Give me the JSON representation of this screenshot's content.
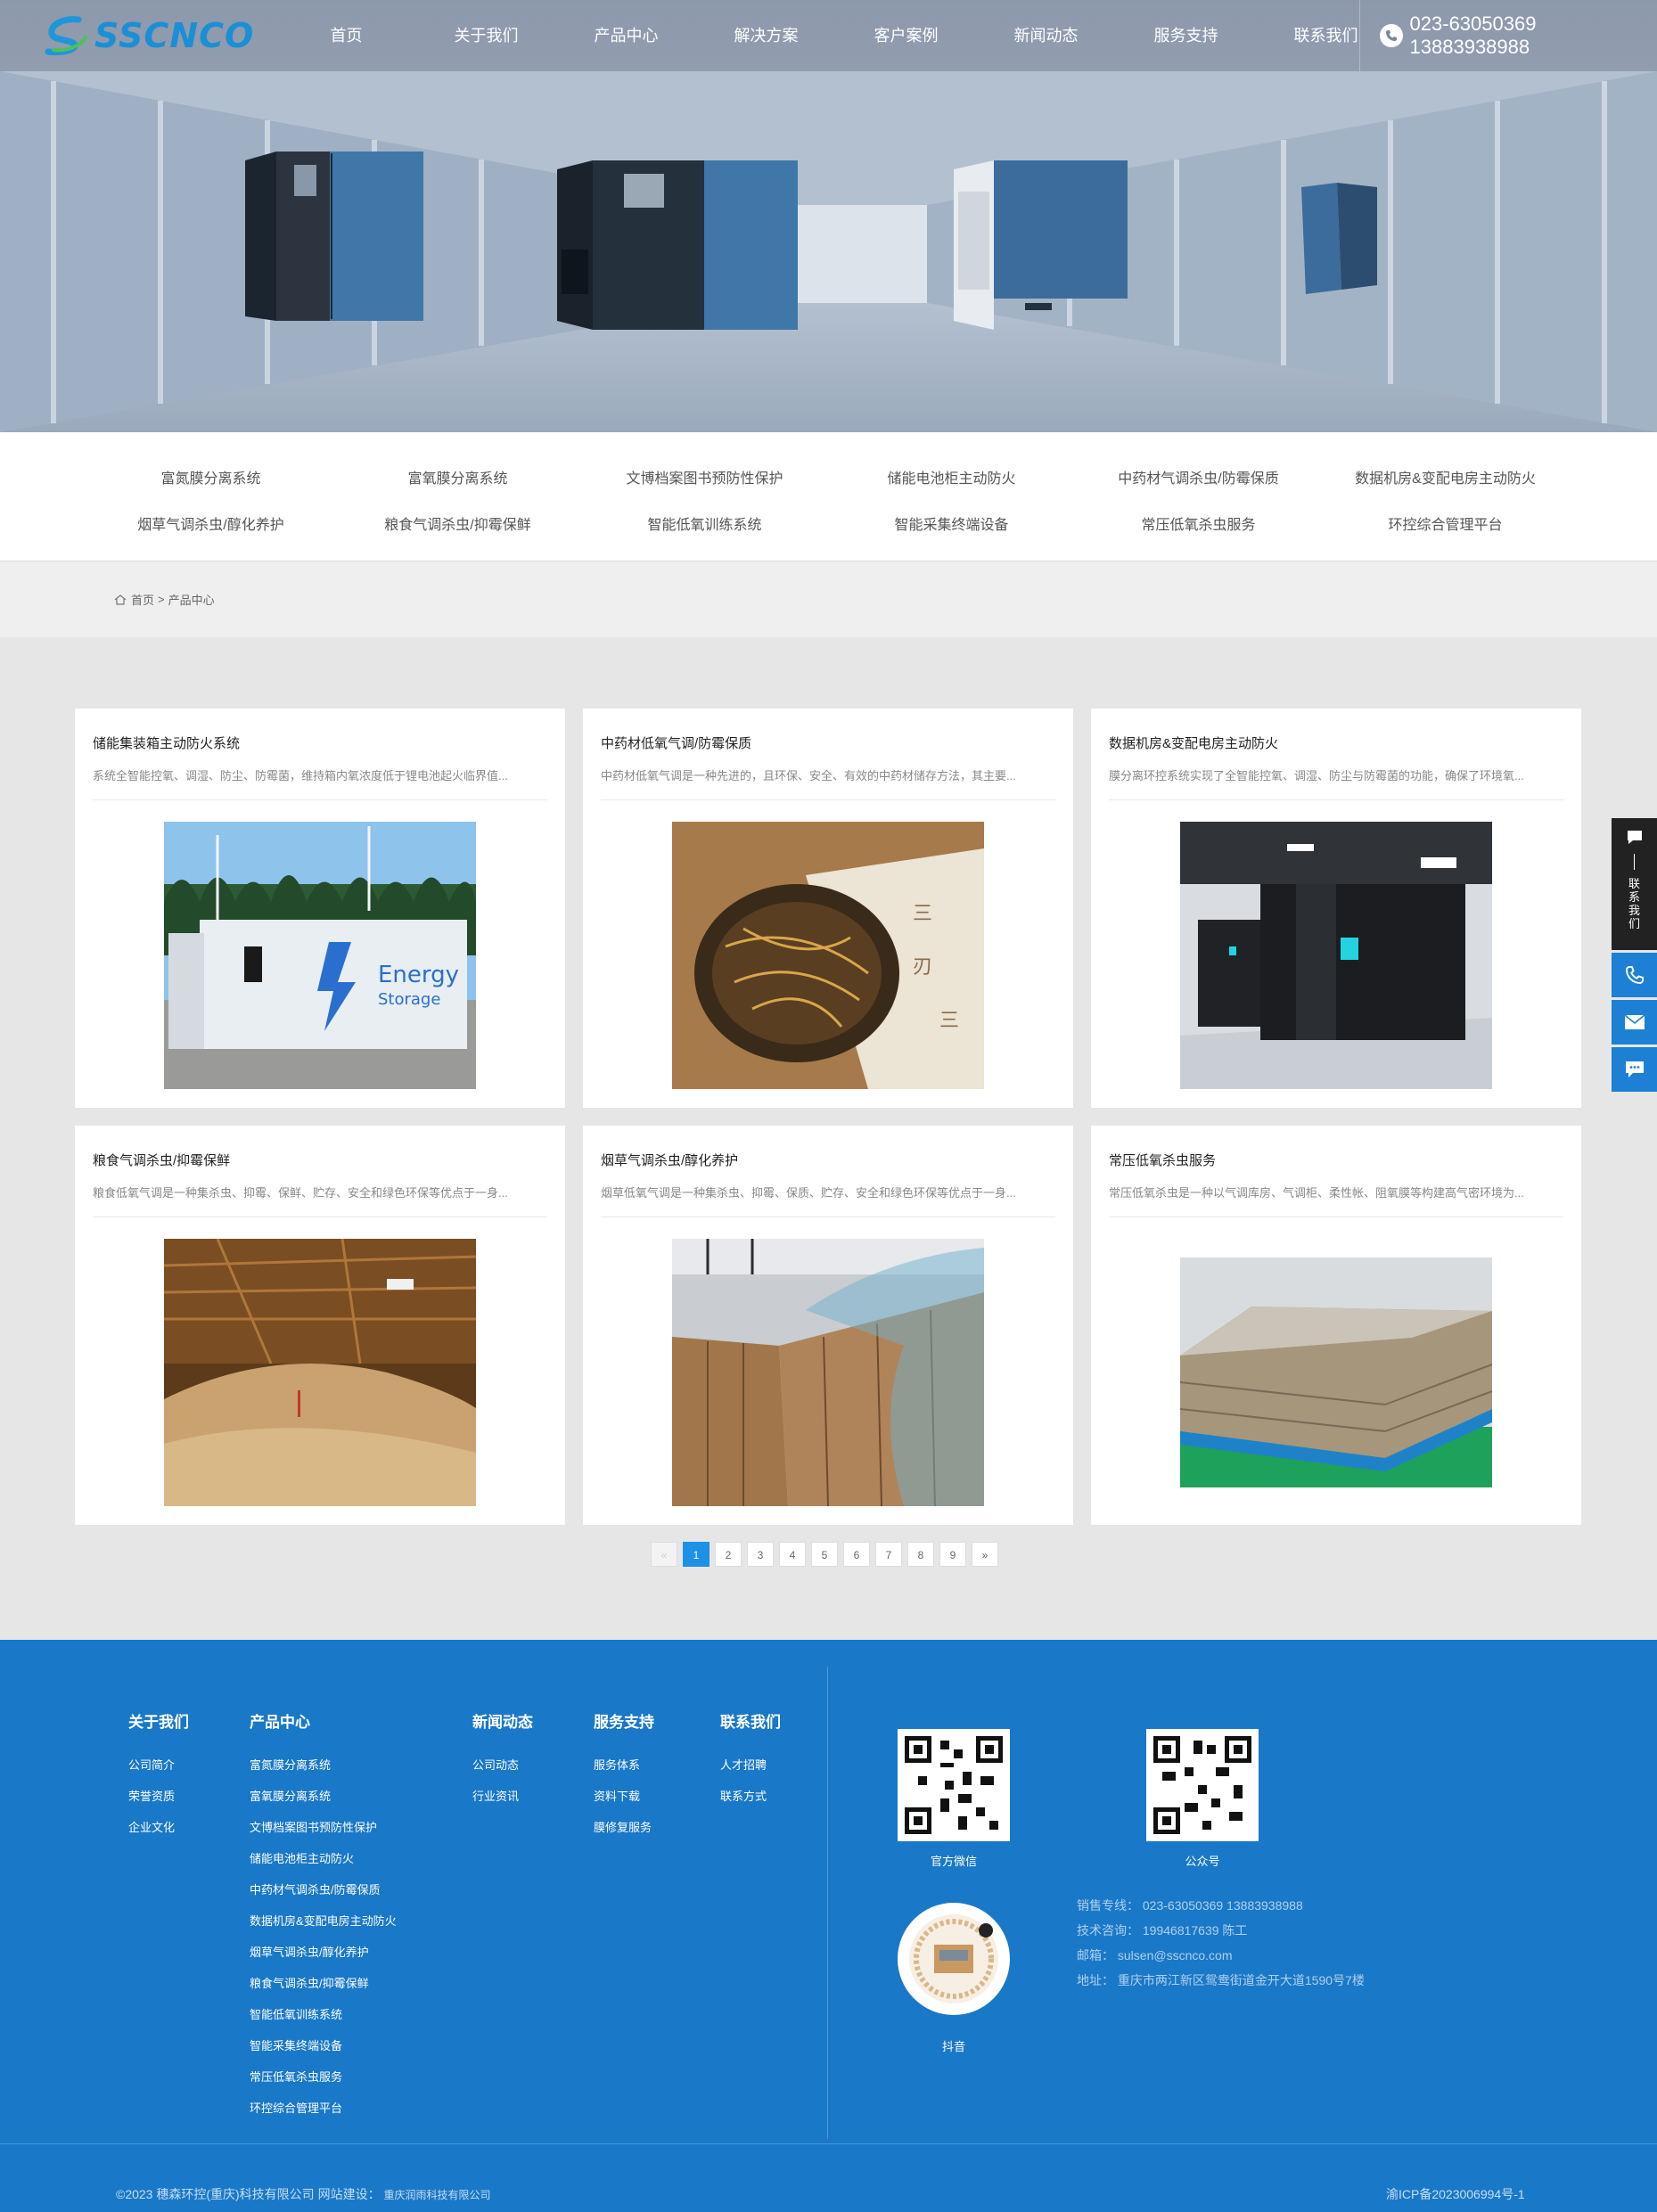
{
  "header": {
    "logo_text": "SSCNCO",
    "nav": [
      "首页",
      "关于我们",
      "产品中心",
      "解决方案",
      "客户案例",
      "新闻动态",
      "服务支持",
      "联系我们"
    ],
    "phone": "023-63050369 13883938988"
  },
  "categories": [
    "富氮膜分离系统",
    "富氧膜分离系统",
    "文博档案图书预防性保护",
    "储能电池柜主动防火",
    "中药材气调杀虫/防霉保质",
    "数据机房&变配电房主动防火",
    "烟草气调杀虫/醇化养护",
    "粮食气调杀虫/抑霉保鲜",
    "智能低氧训练系统",
    "智能采集终端设备",
    "常压低氧杀虫服务",
    "环控综合管理平台"
  ],
  "breadcrumb": {
    "home": "首页",
    "sep": ">",
    "current": "产品中心"
  },
  "products": [
    {
      "title": "储能集装箱主动防火系统",
      "desc": "系统全智能控氧、调湿、防尘、防霉菌，维持箱内氧浓度低于锂电池起火临界值..."
    },
    {
      "title": "中药材低氧气调/防霉保质",
      "desc": "中药材低氧气调是一种先进的，且环保、安全、有效的中药材储存方法，其主要..."
    },
    {
      "title": "数据机房&变配电房主动防火",
      "desc": "膜分离环控系统实现了全智能控氧、调湿、防尘与防霉菌的功能，确保了环境氧..."
    },
    {
      "title": "粮食气调杀虫/抑霉保鲜",
      "desc": "粮食低氧气调是一种集杀虫、抑霉、保鲜、贮存、安全和绿色环保等优点于一身..."
    },
    {
      "title": "烟草气调杀虫/醇化养护",
      "desc": "烟草低氧气调是一种集杀虫、抑霉、保质、贮存、安全和绿色环保等优点于一身..."
    },
    {
      "title": "常压低氧杀虫服务",
      "desc": "常压低氧杀虫是一种以气调库房、气调柜、柔性帐、阻氧膜等构建高气密环境为..."
    }
  ],
  "pager": [
    "«",
    "1",
    "2",
    "3",
    "4",
    "5",
    "6",
    "7",
    "8",
    "9",
    "»"
  ],
  "side": {
    "contact_label": "联系我们"
  },
  "footer": {
    "columns": [
      {
        "title": "关于我们",
        "links": [
          "公司简介",
          "荣誉资质",
          "企业文化"
        ]
      },
      {
        "title": "产品中心",
        "links": [
          "富氮膜分离系统",
          "富氧膜分离系统",
          "文博档案图书预防性保护",
          "储能电池柜主动防火",
          "中药材气调杀虫/防霉保质",
          "数据机房&变配电房主动防火",
          "烟草气调杀虫/醇化养护",
          "粮食气调杀虫/抑霉保鲜",
          "智能低氧训练系统",
          "智能采集终端设备",
          "常压低氧杀虫服务",
          "环控综合管理平台"
        ]
      },
      {
        "title": "新闻动态",
        "links": [
          "公司动态",
          "行业资讯"
        ]
      },
      {
        "title": "服务支持",
        "links": [
          "服务体系",
          "资料下载",
          "膜修复服务"
        ]
      },
      {
        "title": "联系我们",
        "links": [
          "人才招聘",
          "联系方式"
        ]
      }
    ],
    "qr": [
      "官方微信",
      "公众号",
      "抖音"
    ],
    "info": [
      "销售专线：   023-63050369 13883938988",
      "技术咨询：   19946817639 陈工",
      "邮箱：   sulsen@sscnco.com",
      "地址：   重庆市两江新区鸳鸯街道金开大道1590号7楼"
    ],
    "copyright": "©2023 穗森环控(重庆)科技有限公司  网站建设：",
    "builder": "重庆润雨科技有限公司",
    "icp": "渝ICP备2023006994号-1"
  }
}
